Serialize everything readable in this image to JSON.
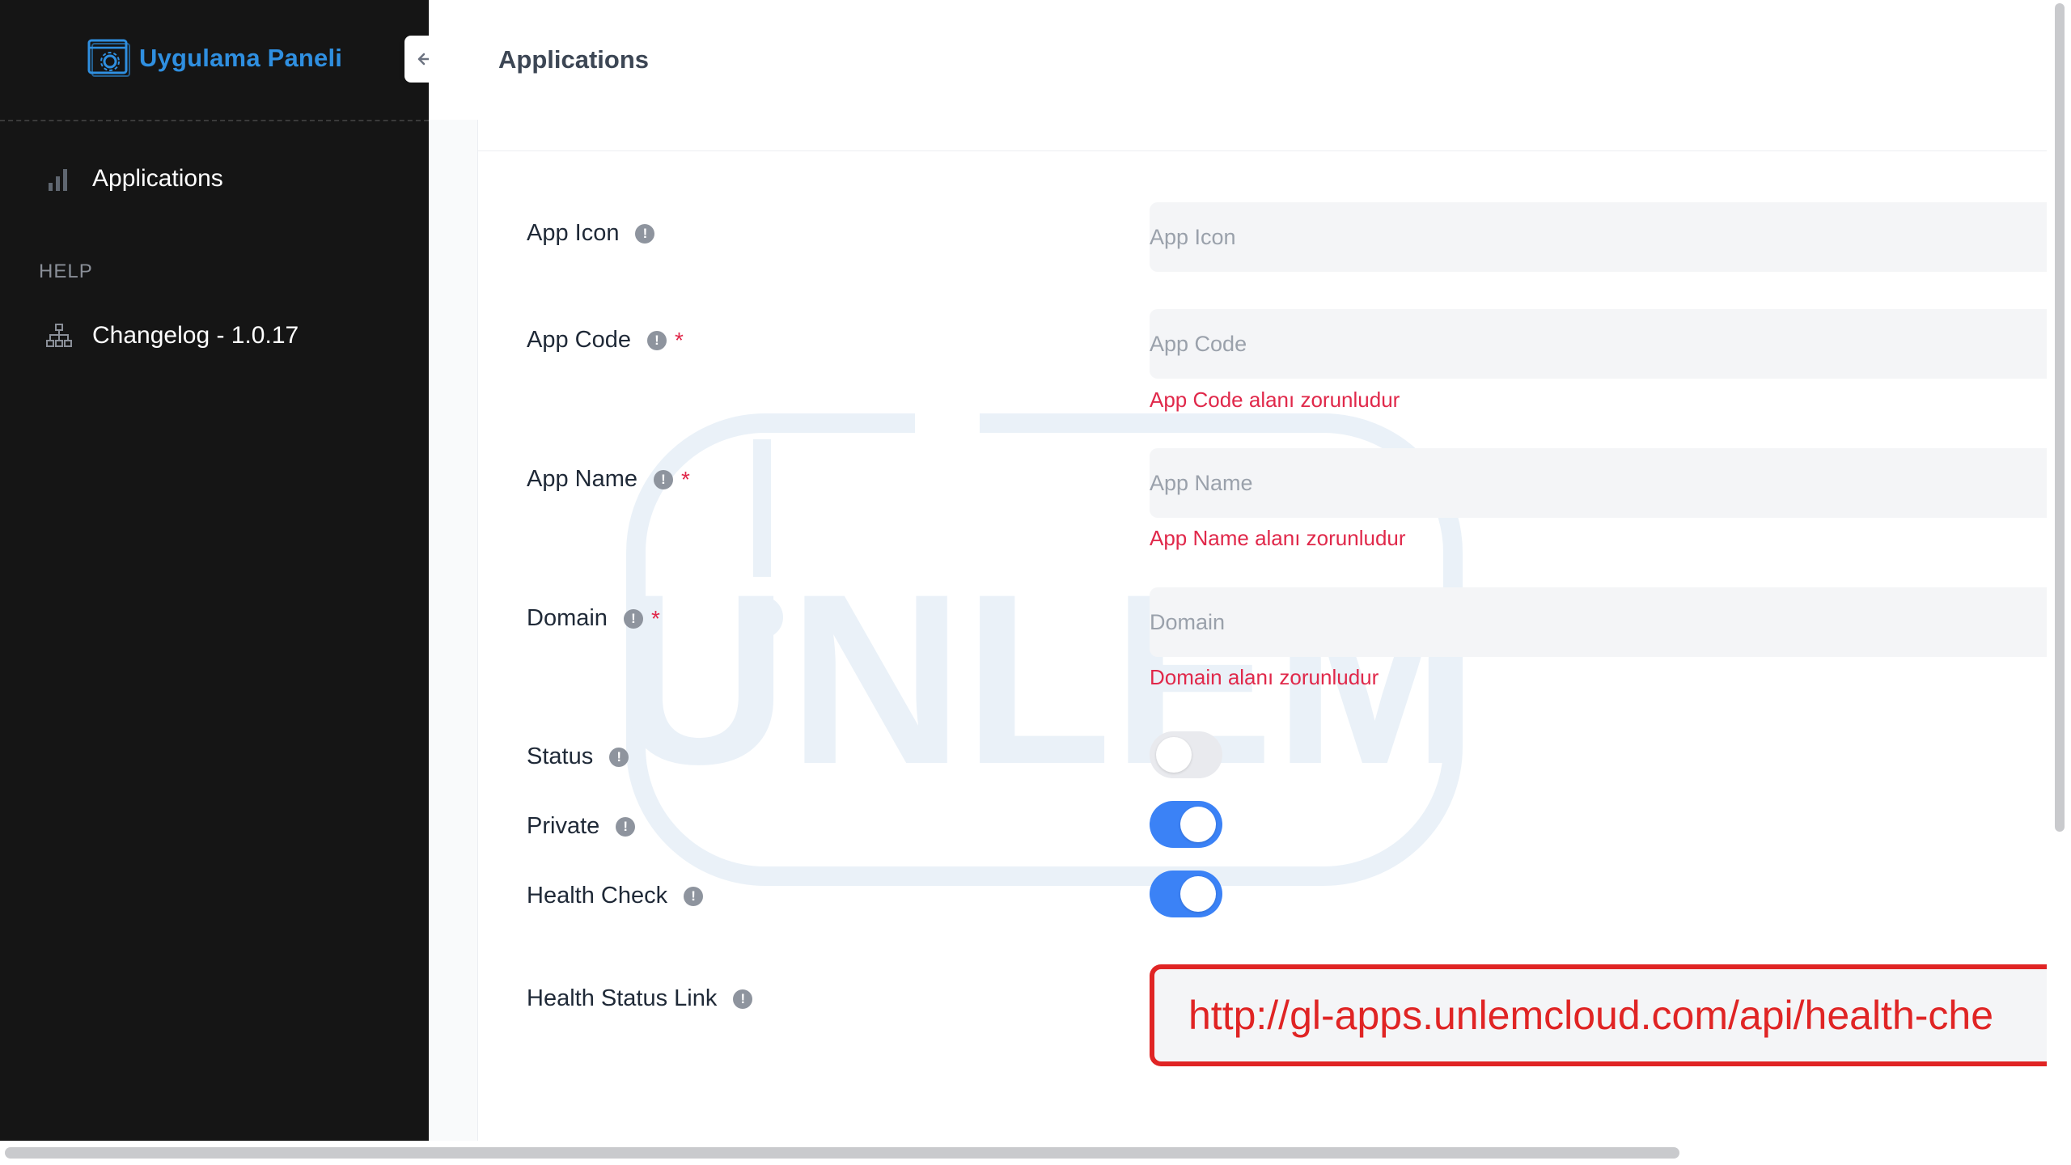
{
  "sidebar": {
    "brand": "Uygulama Paneli",
    "items": [
      {
        "label": "Applications",
        "icon": "bar-chart-icon"
      }
    ],
    "section_label": "HELP",
    "help_items": [
      {
        "label": "Changelog - 1.0.17",
        "icon": "sitemap-icon"
      }
    ]
  },
  "header": {
    "title": "Applications",
    "collapse_icon": "arrow-left-icon"
  },
  "form": {
    "app_icon": {
      "label": "App Icon",
      "placeholder": "App Icon"
    },
    "app_code": {
      "label": "App Code",
      "placeholder": "App Code",
      "error": "App Code alanı zorunludur",
      "required": "*"
    },
    "app_name": {
      "label": "App Name",
      "placeholder": "App Name",
      "error": "App Name alanı zorunludur",
      "required": "*"
    },
    "domain": {
      "label": "Domain",
      "placeholder": "Domain",
      "error": "Domain alanı zorunludur",
      "required": "*"
    },
    "status": {
      "label": "Status",
      "value": false
    },
    "private": {
      "label": "Private",
      "value": true
    },
    "health_check": {
      "label": "Health Check",
      "value": true
    },
    "health_status_link": {
      "label": "Health Status Link",
      "value": "http://gl-apps.unlemcloud.com/api/health-che"
    },
    "info_glyph": "!"
  },
  "watermark_text": "UNLEM",
  "colors": {
    "accent": "#3b82f6",
    "brand": "#2f8fe0",
    "error": "#e0284a",
    "sidebar_bg": "#151515",
    "highlight_border": "#e02424"
  }
}
